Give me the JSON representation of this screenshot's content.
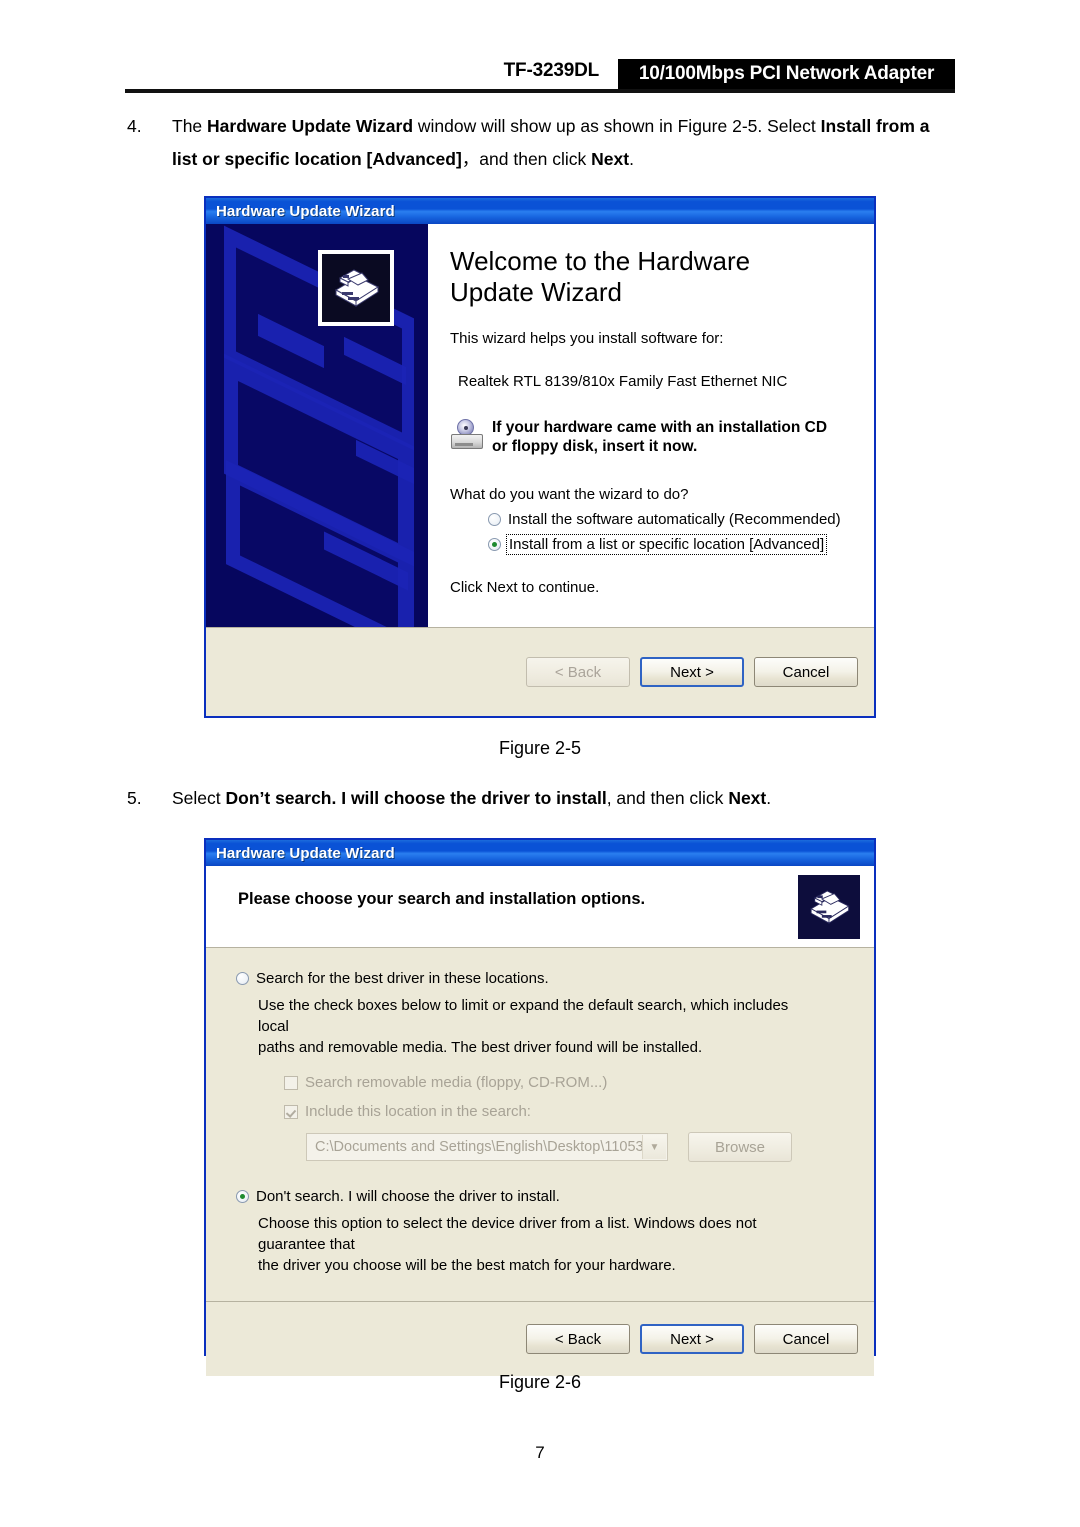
{
  "header": {
    "model": "TF-3239DL",
    "product_badge": "10/100Mbps PCI Network Adapter"
  },
  "steps": [
    {
      "number": "4.",
      "text_parts": [
        {
          "t": "The ",
          "bold": false
        },
        {
          "t": "Hardware Update Wizard",
          "bold": true
        },
        {
          "t": " window will show up as shown in Figure 2-5. Select ",
          "bold": false
        },
        {
          "t": "Install from a list or specific location [Advanced]",
          "bold": true
        },
        {
          "t": "，and then click ",
          "bold": false
        },
        {
          "t": "Next",
          "bold": true
        },
        {
          "t": ".",
          "bold": false
        }
      ]
    },
    {
      "number": "5.",
      "text_parts": [
        {
          "t": "Select ",
          "bold": false
        },
        {
          "t": "Don’t search. I will choose the driver to install",
          "bold": true
        },
        {
          "t": ", and then click ",
          "bold": false
        },
        {
          "t": "Next",
          "bold": true
        },
        {
          "t": ".",
          "bold": false
        }
      ]
    }
  ],
  "figure_captions": {
    "figure_1": "Figure 2-5",
    "figure_2": "Figure 2-6"
  },
  "page_number": "7",
  "dialog_1": {
    "title": "Hardware Update Wizard",
    "heading": "Welcome to the Hardware Update Wizard",
    "intro": "This wizard helps you install software for:",
    "device_name": "Realtek RTL 8139/810x Family Fast Ethernet NIC",
    "cd_notice_line_1": "If your hardware came with an installation CD",
    "cd_notice_line_2": "or floppy disk, insert it now.",
    "question": "What do you want the wizard to do?",
    "options": [
      {
        "label": "Install the software automatically (Recommended)",
        "selected": false,
        "focused": false
      },
      {
        "label": "Install from a list or specific location [Advanced]",
        "selected": true,
        "focused": true
      }
    ],
    "click_next": "Click Next to continue.",
    "buttons": {
      "back": "< Back",
      "next": "Next >",
      "cancel": "Cancel",
      "back_disabled": true,
      "next_default": true
    }
  },
  "dialog_2": {
    "title": "Hardware Update Wizard",
    "header_title": "Please choose your search and installation options.",
    "option_search": {
      "label": "Search for the best driver in these locations.",
      "selected": false,
      "description_line_1": "Use the check boxes below to limit or expand the default search, which includes local",
      "description_line_2": "paths and removable media. The best driver found will be installed."
    },
    "checkboxes": [
      {
        "label": "Search removable media (floppy, CD-ROM...)",
        "checked": false,
        "disabled": true
      },
      {
        "label": "Include this location in the search:",
        "checked": true,
        "disabled": true
      }
    ],
    "location_path": "C:\\Documents and Settings\\English\\Desktop\\11053",
    "browse_label": "Browse",
    "option_dont_search": {
      "label": "Don't search. I will choose the driver to install.",
      "selected": true,
      "description_line_1": "Choose this option to select the device driver from a list.  Windows does not guarantee that",
      "description_line_2": "the driver you choose will be the best match for your hardware."
    },
    "buttons": {
      "back": "< Back",
      "next": "Next >",
      "cancel": "Cancel",
      "back_disabled": false,
      "next_default": true
    }
  },
  "colors": {
    "titlebar_blue": "#0a52d6",
    "dialog_face": "#ece9d8",
    "sidebar_navy": "#06065e",
    "watermark_blue": "#1b24b5",
    "badge_black": "#000000",
    "radio_green": "#1f8b2f"
  }
}
